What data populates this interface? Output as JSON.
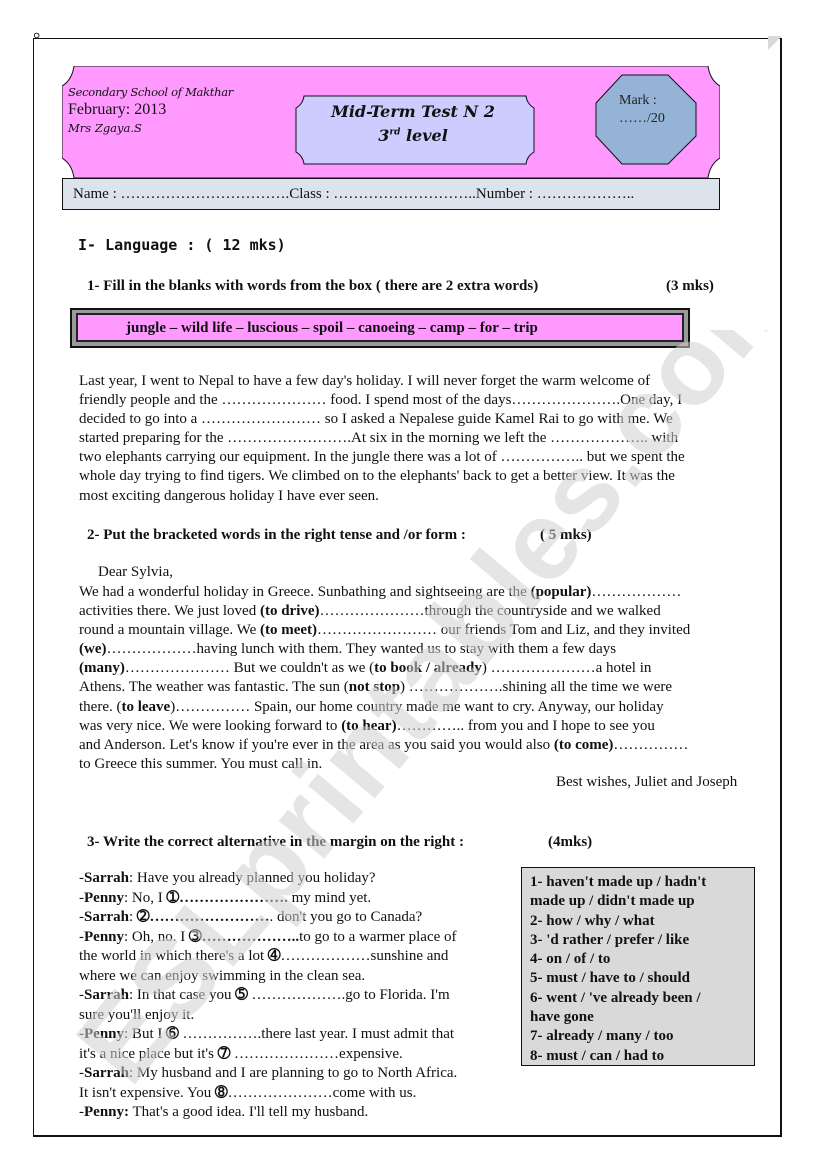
{
  "header": {
    "school": "Secondary School of Makthar",
    "date": "February: 2013",
    "teacher": "Mrs Zgaya.S",
    "title_line1": "Mid-Term Test N 2",
    "title_level_num": "3",
    "title_level_sup": "rd",
    "title_level_word": " level",
    "mark_label": "Mark :",
    "mark_value": "……/20",
    "name_bar": "Name : …………………………….Class : ………………………..Number : ……………….."
  },
  "section": {
    "title": "I- Language :  ( 12 mks)"
  },
  "q1": {
    "heading": "1-  Fill in the blanks with words from the box  ( there are 2 extra words)",
    "marks": "(3 mks)",
    "word_box": "jungle – wild life – luscious – spoil – canoeing – camp – for – trip",
    "text": [
      "Last year, I went to Nepal to have a few day's holiday. I will never forget the warm welcome of",
      "friendly people and the  …………………  food. I spend most of the days………………….One day, I",
      "decided to go into a …………………… so I asked a Nepalese guide Kamel Rai to go with me. We",
      "started preparing for the  …………………….At six in the morning we left the  ……………….. with",
      "two elephants carrying our equipment. In the jungle there was a lot of  …………….. but we spent the",
      "whole day trying to find tigers. We climbed on to the elephants' back to get a better view. It was the",
      "most exciting dangerous holiday I have ever seen."
    ]
  },
  "q2": {
    "heading": "2-  Put the bracketed words in the right tense and /or form :",
    "marks": "( 5 mks)",
    "greeting": "Dear Sylvia,",
    "lines": [
      [
        {
          "t": "We had a wonderful holiday in Greece. Sunbathing and sightseeing are the  "
        },
        {
          "b": "(popular)"
        },
        {
          "t": "………………"
        }
      ],
      [
        {
          "t": "activities there. We just loved  "
        },
        {
          "b": "(to drive)"
        },
        {
          "t": "…………………through the countryside and we walked"
        }
      ],
      [
        {
          "t": "round a mountain village. We "
        },
        {
          "b": "(to meet)"
        },
        {
          "t": "……………………  our friends Tom and Liz, and they invited"
        }
      ],
      [
        {
          "b": "(we)"
        },
        {
          "t": "………………having lunch with them. They wanted us to stay with them a few days"
        }
      ],
      [
        {
          "b": "(many)"
        },
        {
          "t": "………………… But we couldn't as we   ("
        },
        {
          "b": "to book / already"
        },
        {
          "t": ")  …………………a hotel in"
        }
      ],
      [
        {
          "t": "Athens. The weather was fantastic. The sun ("
        },
        {
          "b": "not stop"
        },
        {
          "t": ") ……………….shining all the time we were"
        }
      ],
      [
        {
          "t": "there. ("
        },
        {
          "b": "to leave"
        },
        {
          "t": ")…………… Spain, our home country made me want to cry. Anyway, our holiday"
        }
      ],
      [
        {
          "t": "was very nice. We were looking forward to  "
        },
        {
          "b": "(to hear)"
        },
        {
          "t": "………….. from you and I hope to see you"
        }
      ],
      [
        {
          "t": "and Anderson. Let's know if you're ever in the area as you said you would also "
        },
        {
          "b": "(to come)"
        },
        {
          "t": "……………"
        }
      ],
      [
        {
          "t": "to Greece this summer. You must call in."
        }
      ]
    ],
    "signoff": "Best wishes, Juliet and Joseph"
  },
  "q3": {
    "heading": "3-  Write the correct alternative in the margin on the right :",
    "marks": "(4mks)",
    "dialog": [
      [
        {
          "t": "-"
        },
        {
          "b": "Sarrah"
        },
        {
          "t": ": Have you already planned you holiday?"
        }
      ],
      [
        {
          "t": "-"
        },
        {
          "b": "Penny"
        },
        {
          "t": ": No, I  "
        },
        {
          "b": "➀…………………."
        },
        {
          "t": " my mind yet."
        }
      ],
      [
        {
          "t": "-"
        },
        {
          "b": "Sarrah"
        },
        {
          "t": ": "
        },
        {
          "b": "➁……………………"
        },
        {
          "t": ". don't you go to Canada?"
        }
      ],
      [
        {
          "t": "-"
        },
        {
          "b": "Penny"
        },
        {
          "t": ": Oh, no. I "
        },
        {
          "b": "➂……………….."
        },
        {
          "t": "to go to a warmer place of"
        }
      ],
      [
        {
          "t": "the world in which there's a lot "
        },
        {
          "b": "➃"
        },
        {
          "t": "………………sunshine and"
        }
      ],
      [
        {
          "t": "where we can enjoy swimming in the clean sea."
        }
      ],
      [
        {
          "t": "-"
        },
        {
          "b": "Sarrah"
        },
        {
          "t": ": In that case you "
        },
        {
          "b": "➄"
        },
        {
          "t": " ……………….go to Florida. I'm"
        }
      ],
      [
        {
          "t": "sure you'll enjoy it."
        }
      ],
      [
        {
          "t": "-"
        },
        {
          "b": "Penny"
        },
        {
          "t": ": But I "
        },
        {
          "b": "➅"
        },
        {
          "t": " …………….there last year. I must admit that"
        }
      ],
      [
        {
          "t": "it's a nice place but it's "
        },
        {
          "b": "➆"
        },
        {
          "t": " …………………expensive."
        }
      ],
      [
        {
          "t": "-"
        },
        {
          "b": "Sarrah"
        },
        {
          "t": ": My husband and I are planning to go to North Africa."
        }
      ],
      [
        {
          "t": "It isn't expensive.  You "
        },
        {
          "b": "➇"
        },
        {
          "t": "…………………come with us."
        }
      ],
      [
        {
          "t": "-"
        },
        {
          "b": "Penny:"
        },
        {
          "t": " That's a good idea. I'll tell my husband."
        }
      ]
    ],
    "options": [
      "1- haven't made up / hadn't",
      "made up / didn't made up",
      "2- how / why / what",
      "3- 'd rather / prefer / like",
      "4- on / of / to",
      "5- must / have to / should",
      "6- went / 've already been /",
      "have gone",
      "7- already / many / too",
      "8- must / can / had to"
    ]
  },
  "watermark": "ESLprintables.com",
  "colors": {
    "banner_pink": "#ff99ff",
    "title_lavender": "#ccccff",
    "mark_blue": "#95b3d7",
    "name_bar": "#dce3ed",
    "options_gray": "#d9d9d9"
  }
}
